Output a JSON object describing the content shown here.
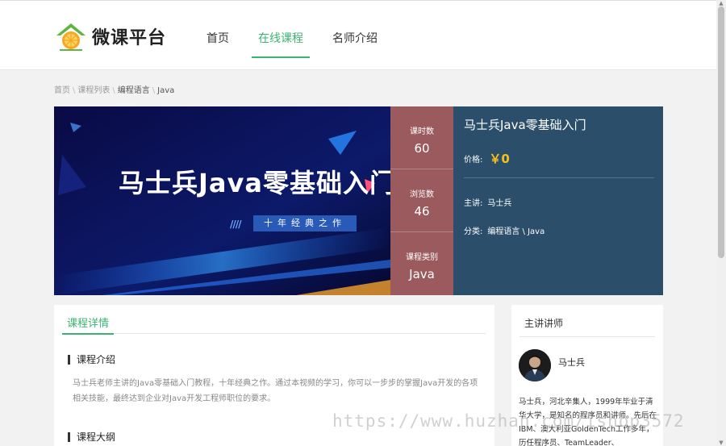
{
  "header": {
    "logo_text": "微课平台",
    "nav": [
      "首页",
      "在线课程",
      "名师介绍"
    ]
  },
  "breadcrumb": [
    "首页",
    "课程列表",
    "编程语言",
    "Java"
  ],
  "banner": {
    "title": "马士兵Java零基础入门",
    "tag": "十年经典之作",
    "stripes": "////"
  },
  "stats": [
    {
      "label": "课时数",
      "value": "60"
    },
    {
      "label": "浏览数",
      "value": "46"
    },
    {
      "label": "课程类别",
      "value": "Java"
    }
  ],
  "info": {
    "title": "马士兵Java零基础入门",
    "price_label": "价格:",
    "price": "￥0",
    "teacher_label": "主讲:",
    "teacher": "马士兵",
    "category_label": "分类:",
    "category": "编程语言 \\ Java"
  },
  "details": {
    "tab": "课程详情",
    "intro_title": "课程介绍",
    "intro_text": "马士兵老师主讲的Java零基础入门教程，十年经典之作。通过本视频的学习，你可以一步步的掌握Java开发的各项相关技能，最终达到企业对Java开发工程师职位的要求。",
    "outline_title": "课程大纲"
  },
  "teacher_card": {
    "title": "主讲讲师",
    "name": "马士兵",
    "bio": "马士兵，河北辛集人，1999年毕业于清华大学，是知名的程序员和讲师。先后在IBM、澳大利亚GoldenTech工作多年，历任程序员、TeamLeader、ProjectManage"
  },
  "watermark": "https://www.huzhan.com/ishop3572",
  "colors": {
    "accent": "#3cb371",
    "stats_bg": "#9b5a5e",
    "info_bg": "#2b4f6a",
    "price": "#f5c01d"
  }
}
